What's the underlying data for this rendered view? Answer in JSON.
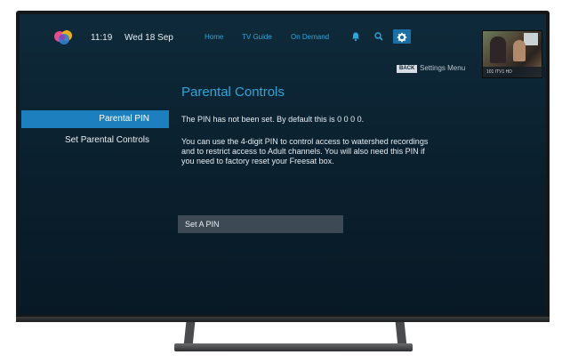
{
  "header": {
    "time": "11:19",
    "date": "Wed 18 Sep",
    "nav": {
      "home": "Home",
      "tv_guide": "TV Guide",
      "on_demand": "On Demand"
    },
    "icons": [
      "bell-icon",
      "search-icon",
      "gear-icon"
    ],
    "back_badge": "BACK",
    "settings_menu": "Settings Menu",
    "preview_channel": "101 ITV1 HD"
  },
  "sidebar": {
    "items": [
      {
        "label": "Parental PIN",
        "selected": true
      },
      {
        "label": "Set Parental Controls",
        "selected": false
      }
    ]
  },
  "main": {
    "title": "Parental Controls",
    "status": "The PIN has not been set. By default this is 0 0 0 0.",
    "description_lines": [
      "You can use the 4-digit PIN to control access to watershed recordings",
      "and to restrict access to Adult channels. You will also need this PIN if",
      "you need to factory reset your Freesat box."
    ],
    "button": "Set A PIN"
  },
  "colors": {
    "accent": "#2fa6d8",
    "selected_bg": "#1e7fbf",
    "screen_bg": "#0e2a3a",
    "button_bg": "#3d4a55"
  }
}
